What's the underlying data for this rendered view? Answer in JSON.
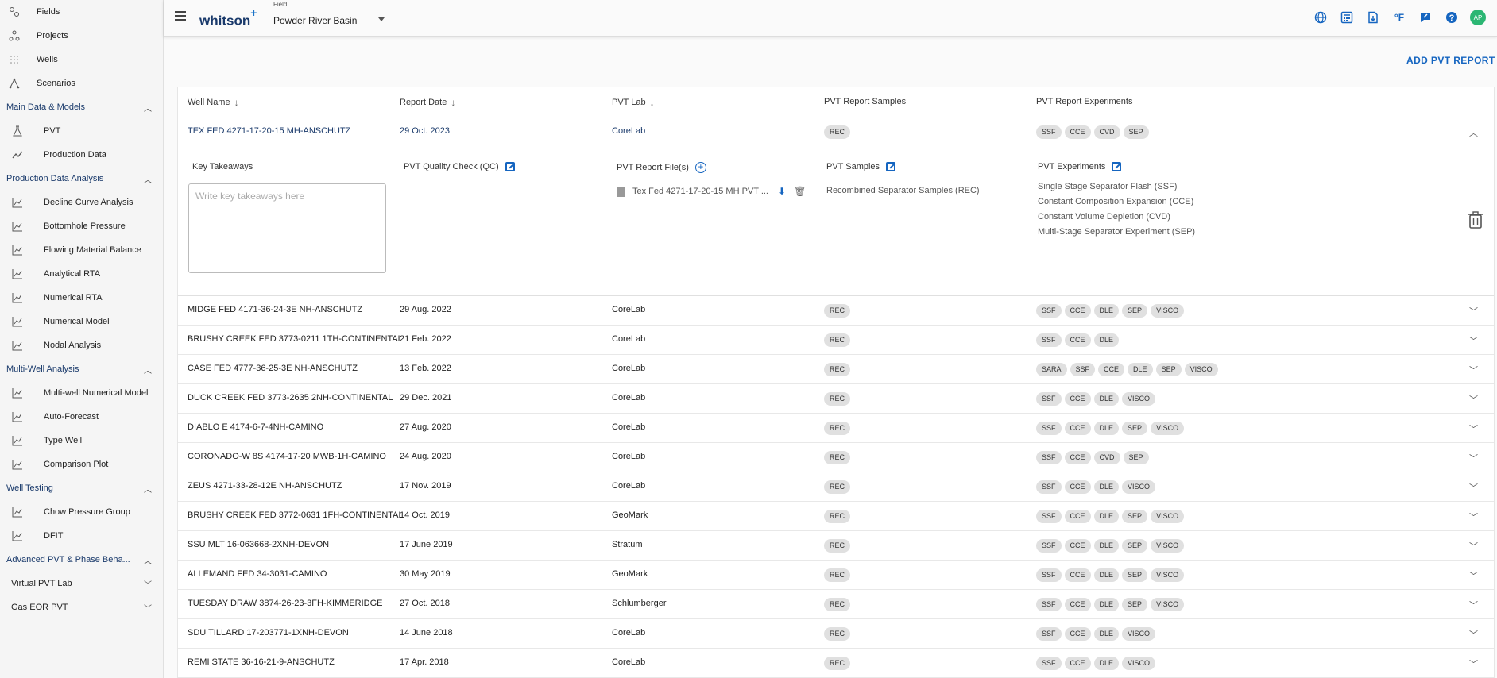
{
  "sidebar": {
    "top_items": [
      {
        "label": "Fields",
        "icon": "fields-icon"
      },
      {
        "label": "Projects",
        "icon": "projects-icon"
      },
      {
        "label": "Wells",
        "icon": "wells-icon"
      },
      {
        "label": "Scenarios",
        "icon": "scenarios-icon"
      }
    ],
    "sections": [
      {
        "label": "Main Data & Models",
        "items": [
          {
            "label": "PVT",
            "icon": "flask-icon"
          },
          {
            "label": "Production Data",
            "icon": "line-chart-icon"
          }
        ]
      },
      {
        "label": "Production Data Analysis",
        "items": [
          {
            "label": "Decline Curve Analysis",
            "icon": "decline-curve-icon"
          },
          {
            "label": "Bottomhole Pressure",
            "icon": "gauge-icon"
          },
          {
            "label": "Flowing Material Balance",
            "icon": "material-balance-icon"
          },
          {
            "label": "Analytical RTA",
            "icon": "analytical-rta-icon"
          },
          {
            "label": "Numerical RTA",
            "icon": "numerical-rta-icon"
          },
          {
            "label": "Numerical Model",
            "icon": "numerical-model-icon"
          },
          {
            "label": "Nodal Analysis",
            "icon": "nodal-analysis-icon"
          }
        ]
      },
      {
        "label": "Multi-Well Analysis",
        "items": [
          {
            "label": "Multi-well Numerical Model",
            "icon": "multiwell-model-icon"
          },
          {
            "label": "Auto-Forecast",
            "icon": "grid-icon"
          },
          {
            "label": "Type Well",
            "icon": "type-well-icon"
          },
          {
            "label": "Comparison Plot",
            "icon": "comparison-plot-icon"
          }
        ]
      },
      {
        "label": "Well Testing",
        "items": [
          {
            "label": "Chow Pressure Group",
            "icon": "chow-pressure-icon"
          },
          {
            "label": "DFIT",
            "icon": "dfit-icon"
          }
        ]
      },
      {
        "label": "Advanced PVT & Phase Beha...",
        "items": []
      }
    ],
    "collapsed": [
      {
        "label": "Virtual PVT Lab"
      },
      {
        "label": "Gas EOR PVT"
      }
    ]
  },
  "topbar": {
    "brand": "whitson",
    "brand_plus": "+",
    "field_label": "Field",
    "field_value": "Powder River Basin",
    "temp_unit": "°F",
    "avatar": "AP"
  },
  "add_button": "ADD PVT REPORT",
  "columns": [
    "Well Name",
    "Report Date",
    "PVT Lab",
    "PVT Report Samples",
    "PVT Report Experiments"
  ],
  "expanded": {
    "well": "TEX FED 4271-17-20-15 MH-ANSCHUTZ",
    "date": "29 Oct. 2023",
    "lab": "CoreLab",
    "samples": [
      "REC"
    ],
    "experiments": [
      "SSF",
      "CCE",
      "CVD",
      "SEP"
    ],
    "key_takeaways_label": "Key Takeaways",
    "key_takeaways_placeholder": "Write key takeaways here",
    "qc_label": "PVT Quality Check (QC)",
    "files_label": "PVT Report File(s)",
    "file_name": "Tex Fed 4271-17-20-15 MH PVT ...",
    "samples_label": "PVT Samples",
    "samples_text": "Recombined Separator Samples (REC)",
    "experiments_label": "PVT Experiments",
    "experiments_list": [
      "Single Stage Separator Flash (SSF)",
      "Constant Composition Expansion (CCE)",
      "Constant Volume Depletion (CVD)",
      "Multi-Stage Separator Experiment (SEP)"
    ]
  },
  "rows": [
    {
      "well": "MIDGE FED 4171-36-24-3E NH-ANSCHUTZ",
      "date": "29 Aug. 2022",
      "lab": "CoreLab",
      "samples": [
        "REC"
      ],
      "experiments": [
        "SSF",
        "CCE",
        "DLE",
        "SEP",
        "VISCO"
      ]
    },
    {
      "well": "BRUSHY CREEK FED 3773-0211 1TH-CONTINENTAL",
      "date": "21 Feb. 2022",
      "lab": "CoreLab",
      "samples": [
        "REC"
      ],
      "experiments": [
        "SSF",
        "CCE",
        "DLE"
      ]
    },
    {
      "well": "CASE FED 4777-36-25-3E NH-ANSCHUTZ",
      "date": "13 Feb. 2022",
      "lab": "CoreLab",
      "samples": [
        "REC"
      ],
      "experiments": [
        "SARA",
        "SSF",
        "CCE",
        "DLE",
        "SEP",
        "VISCO"
      ]
    },
    {
      "well": "DUCK CREEK FED 3773-2635 2NH-CONTINENTAL",
      "date": "29 Dec. 2021",
      "lab": "CoreLab",
      "samples": [
        "REC"
      ],
      "experiments": [
        "SSF",
        "CCE",
        "DLE",
        "VISCO"
      ]
    },
    {
      "well": "DIABLO E 4174-6-7-4NH-CAMINO",
      "date": "27 Aug. 2020",
      "lab": "CoreLab",
      "samples": [
        "REC"
      ],
      "experiments": [
        "SSF",
        "CCE",
        "DLE",
        "SEP",
        "VISCO"
      ]
    },
    {
      "well": "CORONADO-W 8S 4174-17-20 MWB-1H-CAMINO",
      "date": "24 Aug. 2020",
      "lab": "CoreLab",
      "samples": [
        "REC"
      ],
      "experiments": [
        "SSF",
        "CCE",
        "CVD",
        "SEP"
      ]
    },
    {
      "well": "ZEUS 4271-33-28-12E NH-ANSCHUTZ",
      "date": "17 Nov. 2019",
      "lab": "CoreLab",
      "samples": [
        "REC"
      ],
      "experiments": [
        "SSF",
        "CCE",
        "DLE",
        "VISCO"
      ]
    },
    {
      "well": "BRUSHY CREEK FED 3772-0631 1FH-CONTINENTAL",
      "date": "14 Oct. 2019",
      "lab": "GeoMark",
      "samples": [
        "REC"
      ],
      "experiments": [
        "SSF",
        "CCE",
        "DLE",
        "SEP",
        "VISCO"
      ]
    },
    {
      "well": "SSU MLT 16-063668-2XNH-DEVON",
      "date": "17 June 2019",
      "lab": "Stratum",
      "samples": [
        "REC"
      ],
      "experiments": [
        "SSF",
        "CCE",
        "DLE",
        "SEP",
        "VISCO"
      ]
    },
    {
      "well": "ALLEMAND FED 34-3031-CAMINO",
      "date": "30 May 2019",
      "lab": "GeoMark",
      "samples": [
        "REC"
      ],
      "experiments": [
        "SSF",
        "CCE",
        "DLE",
        "SEP",
        "VISCO"
      ]
    },
    {
      "well": "TUESDAY DRAW 3874-26-23-3FH-KIMMERIDGE",
      "date": "27 Oct. 2018",
      "lab": "Schlumberger",
      "samples": [
        "REC"
      ],
      "experiments": [
        "SSF",
        "CCE",
        "DLE",
        "SEP",
        "VISCO"
      ]
    },
    {
      "well": "SDU TILLARD 17-203771-1XNH-DEVON",
      "date": "14 June 2018",
      "lab": "CoreLab",
      "samples": [
        "REC"
      ],
      "experiments": [
        "SSF",
        "CCE",
        "DLE",
        "VISCO"
      ]
    },
    {
      "well": "REMI STATE 36-16-21-9-ANSCHUTZ",
      "date": "17 Apr. 2018",
      "lab": "CoreLab",
      "samples": [
        "REC"
      ],
      "experiments": [
        "SSF",
        "CCE",
        "DLE",
        "VISCO"
      ]
    }
  ],
  "colors": {
    "accent": "#1565c0",
    "brand": "#1a3a6b",
    "avatar": "#2bb673",
    "chip": "#e0e0e0"
  }
}
